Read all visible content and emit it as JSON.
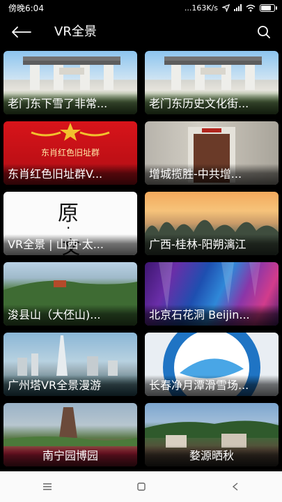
{
  "status_bar": {
    "time": "傍晚6:04",
    "network_speed": "...163K/s",
    "battery_level": 0.85,
    "icons": [
      "location-arrow-icon",
      "signal-icon",
      "wifi-icon",
      "battery-icon"
    ]
  },
  "app_bar": {
    "title": "VR全景",
    "back_icon": "arrow-left-icon",
    "search_icon": "search-icon"
  },
  "cards": [
    {
      "title": "老门东下雪了非常...",
      "thumb": "gate"
    },
    {
      "title": "老门东历史文化街...",
      "thumb": "gate"
    },
    {
      "title": "东肖红色旧址群V...",
      "thumb": "red",
      "banner": "东肖红色旧址群"
    },
    {
      "title": "增城揽胜-中共增...",
      "thumb": "door"
    },
    {
      "title": "VR全景 | 山西·太...",
      "thumb": "paper",
      "chars": [
        "原",
        "·",
        "文"
      ]
    },
    {
      "title": "广西-桂林-阳朔漓江",
      "thumb": "karst"
    },
    {
      "title": "浚县山（大伾山)...",
      "thumb": "hill"
    },
    {
      "title": "北京石花洞 Beijin...",
      "thumb": "cave"
    },
    {
      "title": "广州塔VR全景漫游",
      "thumb": "tower"
    },
    {
      "title": "长春净月潭滑雪场...",
      "thumb": "badge"
    },
    {
      "title": "南宁园博园",
      "thumb": "park"
    },
    {
      "title": "婺源晒秋",
      "thumb": "village"
    }
  ],
  "nav_bar": {
    "menu_icon": "menu-icon",
    "home_icon": "home-square-icon",
    "back_icon": "back-triangle-icon"
  },
  "colors": {
    "background": "#000000",
    "nav_bar": "#fafafa",
    "accent_red": "#d8141a",
    "badge_blue": "#1f74c4"
  }
}
